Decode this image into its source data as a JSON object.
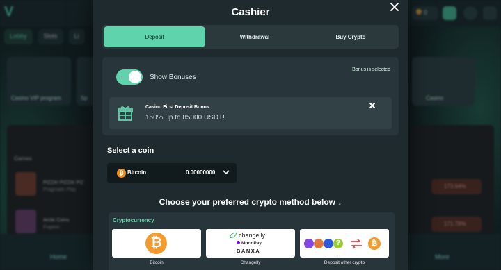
{
  "background": {
    "nav_items": [
      "Lobby",
      "Slots",
      "Li"
    ],
    "balance_label": "0",
    "cards": [
      {
        "caption": "Casino VIP program"
      },
      {
        "caption": "Sp"
      },
      {
        "caption": "Casino"
      }
    ],
    "games_title": "Games",
    "games": [
      {
        "name": "PIZZA! PIZZA! PIZ",
        "provider": "Pragmatic Play"
      },
      {
        "name": "Arctic Coins",
        "provider": "Fugaso"
      }
    ],
    "right_badges": [
      "173.64%",
      "171.78%"
    ],
    "bottom_nav": {
      "home": "Home",
      "more": "More"
    }
  },
  "modal": {
    "title": "Cashier",
    "tabs": [
      {
        "label": "Deposit",
        "active": true
      },
      {
        "label": "Withdrawal",
        "active": false
      },
      {
        "label": "Buy Crypto",
        "active": false
      }
    ],
    "bonus": {
      "toggle_on": true,
      "show_bonuses_label": "Show Bonuses",
      "status": "Bonus is selected",
      "card_title": "Casino First Deposit Bonus",
      "card_amount": "150% up to 85000 USDT!"
    },
    "coin": {
      "label": "Select a coin",
      "selected_name": "Bitcoin",
      "selected_amount": "0.00000000",
      "icon": "bitcoin-icon"
    },
    "methods_heading": "Choose your preferred crypto method below ↓",
    "crypto": {
      "section_label": "Cryptocurrency",
      "methods": [
        {
          "caption": "Bitcoin",
          "icon": "bitcoin-icon"
        },
        {
          "caption": "Changelly",
          "brands": [
            "changelly",
            "MoonPay",
            "BANXA"
          ]
        },
        {
          "caption": "Deposit other crypto",
          "icon": "multi-crypto-icons"
        }
      ]
    }
  },
  "colors": {
    "accent": "#5fd3ac",
    "modal_bg": "#1f2a2e",
    "panel_bg": "#28353a",
    "bitcoin": "#f29a2e"
  }
}
